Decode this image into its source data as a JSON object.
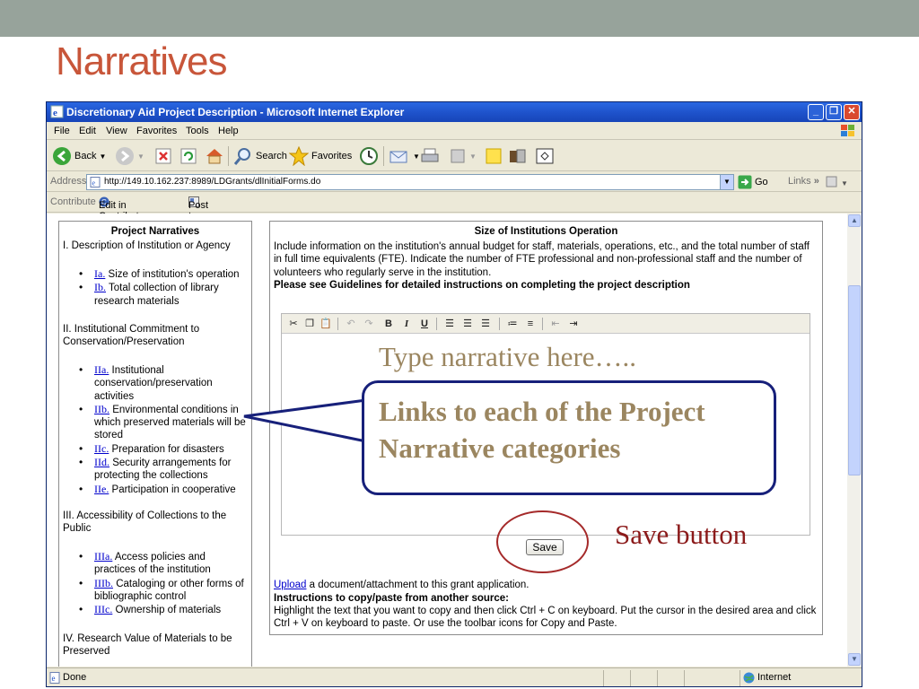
{
  "slide": {
    "title": "Narratives"
  },
  "window": {
    "title": "Discretionary Aid Project Description - Microsoft Internet Explorer",
    "controls": [
      "_",
      "❐",
      "✕"
    ]
  },
  "menu": [
    "File",
    "Edit",
    "View",
    "Favorites",
    "Tools",
    "Help"
  ],
  "toolbar": {
    "back_label": "Back",
    "search_label": "Search",
    "favorites_label": "Favorites"
  },
  "address": {
    "label": "Address",
    "url": "http://149.10.162.237:8989/LDGrants/dlInitialForms.do",
    "go_label": "Go",
    "links_label": "Links",
    "more": "»"
  },
  "contribute": {
    "label": "Contribute",
    "edit_label": "Edit in Contribute",
    "post_label": "Post to Blog"
  },
  "nav": {
    "heading": "Project Narratives",
    "sections": [
      {
        "title": "I. Description of Institution or Agency",
        "items": [
          {
            "link": "Ia.",
            "text": " Size of institution's operation"
          },
          {
            "link": "Ib.",
            "text": " Total collection of library research materials"
          }
        ]
      },
      {
        "title": "II. Institutional Commitment to Conservation/Preservation",
        "items": [
          {
            "link": "IIa.",
            "text": " Institutional conservation/preservation activities"
          },
          {
            "link": "IIb.",
            "text": " Environmental conditions in which preserved materials will be stored"
          },
          {
            "link": "IIc.",
            "text": " Preparation for disasters"
          },
          {
            "link": "IId.",
            "text": " Security arrangements for protecting the collections"
          },
          {
            "link": "IIe.",
            "text": " Participation in cooperative"
          }
        ]
      },
      {
        "title": "III. Accessibility of Collections to the Public",
        "items": [
          {
            "link": "IIIa.",
            "text": " Access policies and practices of the institution"
          },
          {
            "link": "IIIb.",
            "text": " Cataloging or other forms of bibliographic control"
          },
          {
            "link": "IIIc.",
            "text": " Ownership of materials"
          }
        ]
      },
      {
        "title": "IV. Research Value of Materials to be Preserved",
        "items": []
      }
    ]
  },
  "main": {
    "heading": "Size of Institutions Operation",
    "instructions": "Include information on the institution's annual budget for staff, materials, operations, etc., and the total number of staff in full time equivalents (FTE). Indicate the number of FTE professional and non-professional staff and the number of volunteers who regularly serve in the institution.",
    "guidelines": "Please see Guidelines for detailed instructions on completing the project description",
    "save_label": "Save",
    "upload_link": "Upload",
    "upload_text": " a document/attachment to this grant application.",
    "copy_heading": "Instructions to copy/paste from another source:",
    "copy_text": "Highlight the text that you want to copy and then click Ctrl + C on keyboard. Put the cursor in the desired area and click Ctrl + V on keyboard to paste. Or use the toolbar icons for Copy and Paste."
  },
  "editor_toolbar": {
    "bold": "B",
    "italic": "I",
    "underline": "U"
  },
  "status": {
    "text": "Done",
    "zone": "Internet"
  },
  "annotations": {
    "type_hint": "Type narrative here…..",
    "callout": "Links to each of the Project Narrative categories",
    "save_label": "Save button"
  },
  "colors": {
    "title": "#c8563a",
    "annotation_text": "#9b8660",
    "callout_border": "#17207a",
    "save_circle": "#a52a2a",
    "link": "#0000cc"
  }
}
